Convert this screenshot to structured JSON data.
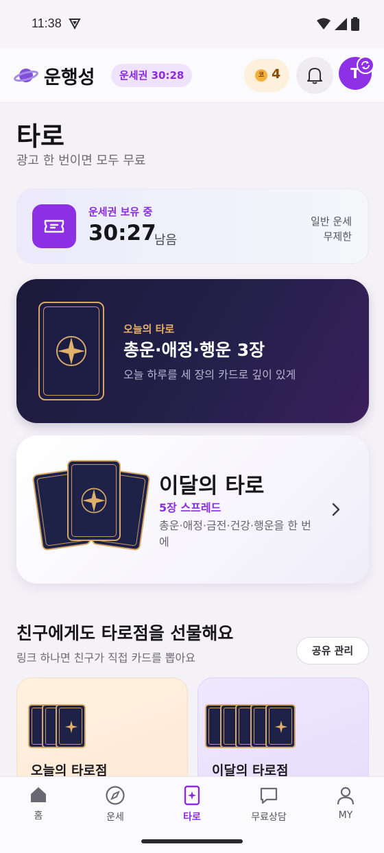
{
  "status_bar": {
    "time": "11:38"
  },
  "header": {
    "app_title": "운행성",
    "ticket_pill": "운세권 30:28",
    "coin_symbol": "코",
    "coin_count": "4",
    "avatar_initial": "T"
  },
  "page": {
    "title": "타로",
    "subtitle": "광고 한 번이면 모두 무료"
  },
  "ticket_card": {
    "label": "운세권 보유 중",
    "time": "30:27",
    "remaining": "남음",
    "note_line1": "일반 운세",
    "note_line2": "무제한"
  },
  "daily_card": {
    "kicker": "오늘의 타로",
    "title": "총운·애정·행운 3장",
    "description": "오늘 하루를 세 장의 카드로 깊이 있게"
  },
  "monthly_card": {
    "title": "이달의 타로",
    "kicker": "5장 스프레드",
    "description": "총운·애정·금전·건강·행운을 한 번에"
  },
  "gift_section": {
    "title": "친구에게도 타로점을 선물해요",
    "subtitle": "링크 하나면 친구가 직접 카드를 뽑아요",
    "share_button": "공유 관리",
    "cards": [
      {
        "label": "오늘의 타로점"
      },
      {
        "label": "이달의 타로점"
      }
    ]
  },
  "bottom_nav": {
    "items": [
      {
        "label": "홈",
        "icon": "home-icon"
      },
      {
        "label": "운세",
        "icon": "compass-icon"
      },
      {
        "label": "타로",
        "icon": "tarot-card-icon",
        "active": true
      },
      {
        "label": "무료상담",
        "icon": "chat-bubble-icon"
      },
      {
        "label": "MY",
        "icon": "person-icon"
      }
    ]
  },
  "colors": {
    "accent": "#8a2be2",
    "gold": "#d7a767",
    "navy": "#1e2249"
  }
}
